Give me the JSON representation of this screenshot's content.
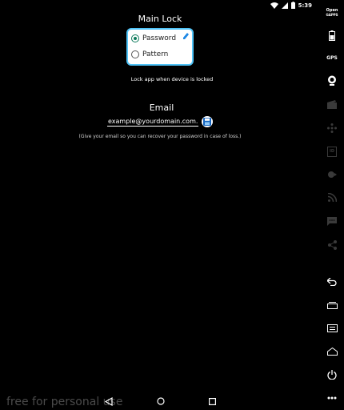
{
  "status_bar": {
    "time": "5:39"
  },
  "main_lock": {
    "title": "Main Lock",
    "options": [
      {
        "label": "Password",
        "selected": true
      },
      {
        "label": "Pattern",
        "selected": false
      }
    ],
    "caption": "Lock app when device is locked"
  },
  "email": {
    "title": "Email",
    "value": "example@yourdomain.com.",
    "hint": "(Give your email so you can recover your password in case of loss.)"
  },
  "side_panel": {
    "gapps_label_top": "Open",
    "gapps_label_bottom": "GAPPS",
    "gps_label": "GPS",
    "id_label": "ID"
  },
  "watermark": "free for personal use",
  "colors": {
    "accent": "#4fc3f7",
    "radio": "#0c7a5b",
    "background": "#000000"
  }
}
